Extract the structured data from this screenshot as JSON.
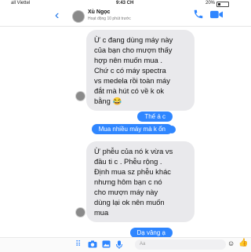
{
  "status_bar": {
    "carrier": "all Viettel",
    "time": "9:43 CH",
    "battery": "20%"
  },
  "header": {
    "contact_name": "Xù Ngọc",
    "presence": "Hoạt động 10 phút trước"
  },
  "messages": [
    {
      "direction": "in",
      "text": "Ừ c đang dùng máy này\ncủa bạn cho mượn thấy\nhợp nên muốn mua .\nChứ c có máy  spectra\nvs medela rồi toàn máy\nđắt mà hút có về k ok\nbằng 😂"
    },
    {
      "direction": "out",
      "text": "Thế á c"
    },
    {
      "direction": "out",
      "text": "Mua nhiều máy mà k ổn"
    },
    {
      "direction": "in",
      "text": "Ừ phễu của nó k vừa vs\nđầu ti c . Phễu rộng .\nĐịnh mua sz phễu khác\nnhưng hôm bạn c nó\ncho mượn máy này\ndùng lại ok nên muốn\nmua"
    },
    {
      "direction": "out",
      "text": "Dạ vâng ạ"
    }
  ],
  "composer": {
    "placeholder": "Aa"
  },
  "colors": {
    "accent": "#2f86ff",
    "incoming_bubble": "#e9e9ec"
  }
}
